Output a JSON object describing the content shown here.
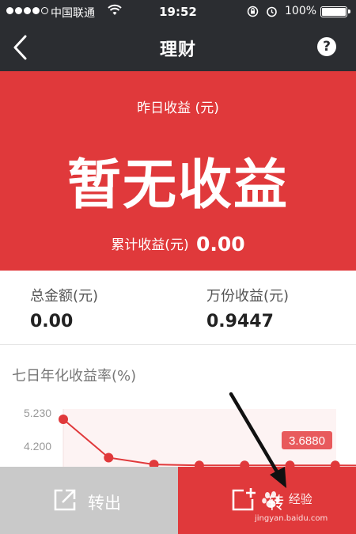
{
  "status_bar": {
    "carrier": "中国联通",
    "time": "19:52",
    "battery": "100%"
  },
  "nav": {
    "title": "理财",
    "help_label": "?"
  },
  "summary": {
    "yesterday_label": "昨日收益 (元)",
    "yesterday_value": "暂无收益",
    "cumulative_label": "累计收益(元)",
    "cumulative_value": "0.00"
  },
  "stats": {
    "total_label": "总金额(元)",
    "total_value": "0.00",
    "per10k_label": "万份收益(元)",
    "per10k_value": "0.9447"
  },
  "chart_data": {
    "type": "line",
    "title": "七日年化收益率(%)",
    "y_ticks": [
      "5.230",
      "4.200"
    ],
    "values": [
      5.23,
      3.95,
      3.72,
      3.69,
      3.69,
      3.69,
      3.69,
      3.688
    ],
    "highlight_label": "3.6880",
    "color": "#e0393b"
  },
  "actions": {
    "transfer_out_label": "转出",
    "transfer_in_label": "转"
  },
  "watermark": {
    "text": "经验",
    "url": "jingyan.baidu.com"
  }
}
